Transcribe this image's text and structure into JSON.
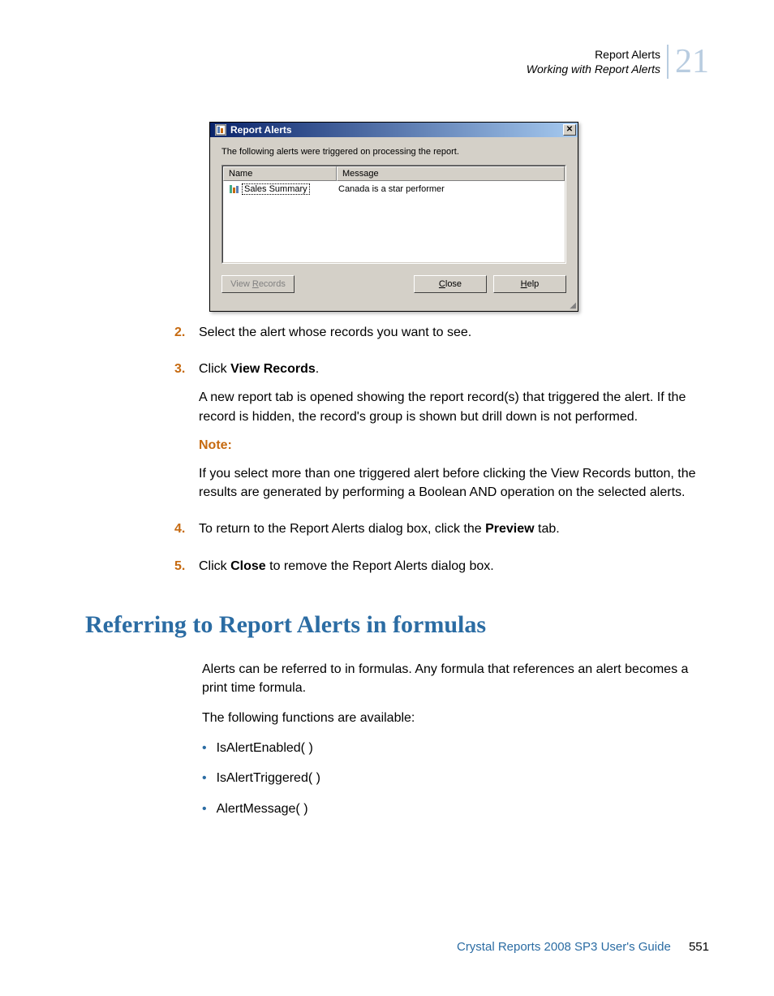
{
  "header": {
    "title": "Report Alerts",
    "subtitle": "Working with Report Alerts",
    "chapter_num": "21"
  },
  "dialog": {
    "title": "Report Alerts",
    "close": "✕",
    "intro": "The following alerts were triggered on processing the report.",
    "col_name": "Name",
    "col_message": "Message",
    "row1_name": "Sales Summary",
    "row1_message": "Canada is a star performer",
    "btn_view": "View Records",
    "btn_close": "Close",
    "btn_help": "Help"
  },
  "steps": {
    "s2_num": "2.",
    "s2_text": "Select the alert whose records you want to see.",
    "s3_num": "3.",
    "s3_prefix": "Click ",
    "s3_bold": "View Records",
    "s3_suffix": ".",
    "s3_para": "A new report tab is opened showing the report record(s) that triggered the alert. If the record is hidden, the record's group is shown but drill down is not performed.",
    "note_label": "Note:",
    "note_text": "If you select more than one triggered alert before clicking the View Records button, the results are generated by performing a Boolean AND operation on the selected alerts.",
    "s4_num": "4.",
    "s4_prefix": "To return to the Report Alerts dialog box, click the ",
    "s4_bold": "Preview",
    "s4_suffix": " tab.",
    "s5_num": "5.",
    "s5_prefix": "Click ",
    "s5_bold": "Close",
    "s5_suffix": " to remove the Report Alerts dialog box."
  },
  "section": {
    "heading": "Referring to Report Alerts in formulas",
    "p1": "Alerts can be referred to in formulas. Any formula that references an alert becomes a print time formula.",
    "p2": "The following functions are available:",
    "b1": "IsAlertEnabled( )",
    "b2": "IsAlertTriggered( )",
    "b3": "AlertMessage( )"
  },
  "footer": {
    "text": "Crystal Reports 2008 SP3 User's Guide",
    "page": "551"
  }
}
